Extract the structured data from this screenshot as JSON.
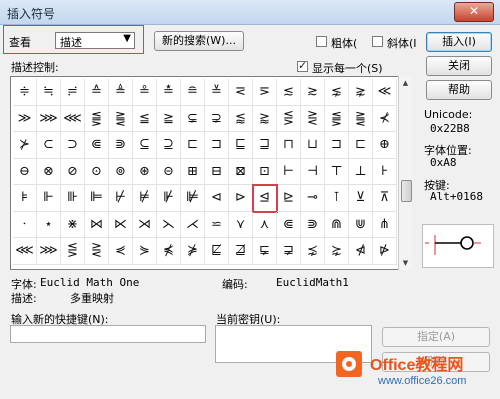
{
  "window": {
    "title": "插入符号",
    "close_label": "✕"
  },
  "toolbar": {
    "view_label": "查看",
    "view_value": "描述",
    "new_search_label": "新的搜索(W)...",
    "bold_label": "粗体(",
    "italic_label": "斜体(I",
    "insert_label": "插入(I)",
    "close_label": "关闭",
    "help_label": "帮助"
  },
  "grid_section": {
    "label": "描述控制:",
    "show_each_label": "显示每一个(S)",
    "rows": [
      [
        "≑",
        "≒",
        "≓",
        "≙",
        "≜",
        "≗",
        "≛",
        "≘",
        "≚",
        "⋜",
        "⋝",
        "≲",
        "≳",
        "⋦",
        "⋧",
        "≪"
      ],
      [
        "≫",
        "⋙",
        "⋘",
        "⪋",
        "⪌",
        "≦",
        "≧",
        "⊊",
        "⊋",
        "⪅",
        "⪆",
        "⋚",
        "⋛",
        "⪋",
        "⪌",
        "⊀"
      ],
      [
        "⊁",
        "⊂",
        "⊃",
        "⋐",
        "⋑",
        "⊆",
        "⊇",
        "⊏",
        "⊐",
        "⊑",
        "⊒",
        "⊓",
        "⊔",
        "⊐",
        "⊏",
        "⊕"
      ],
      [
        "⊖",
        "⊗",
        "⊘",
        "⊙",
        "⊚",
        "⊛",
        "⊝",
        "⊞",
        "⊟",
        "⊠",
        "⊡",
        "⊢",
        "⊣",
        "⊤",
        "⊥",
        "⊦"
      ],
      [
        "⊧",
        "⊩",
        "⊪",
        "⊫",
        "⊬",
        "⊭",
        "⊮",
        "⊯",
        "⊲",
        "⊳",
        "⊴",
        "⊵",
        "⊸",
        "⊺",
        "⊻",
        "⊼"
      ],
      [
        "⋅",
        "⋆",
        "⋇",
        "⋈",
        "⋉",
        "⋊",
        "⋋",
        "⋌",
        "⋍",
        "⋎",
        "⋏",
        "⋐",
        "⋑",
        "⋒",
        "⋓",
        "⋔"
      ],
      [
        "⋘",
        "⋙",
        "⋚",
        "⋛",
        "⋞",
        "⋟",
        "⋠",
        "⋡",
        "⋢",
        "⋣",
        "⋤",
        "⋥",
        "⋨",
        "⋩",
        "⋪",
        "⋫"
      ]
    ],
    "selected_row": 4,
    "selected_col": 10
  },
  "details": {
    "unicode_label": "Unicode:",
    "unicode_value": "0x22B8",
    "pos_label": "字体位置:",
    "pos_value": "0xA8",
    "key_label": "按键:",
    "key_value": "Alt+0168"
  },
  "font_info": {
    "font_label": "字体:",
    "font_value": "Euclid Math One",
    "encoding_label": "编码:",
    "encoding_value": "EuclidMath1",
    "desc_label": "描述:",
    "desc_value": "多重映射"
  },
  "shortcut": {
    "new_label": "输入新的快捷键(N):",
    "current_label": "当前密钥(U):",
    "assign_label": "指定(A)",
    "remove_label": "删除"
  },
  "watermark": {
    "name": "Office教程网",
    "url": "www.office26.com"
  }
}
